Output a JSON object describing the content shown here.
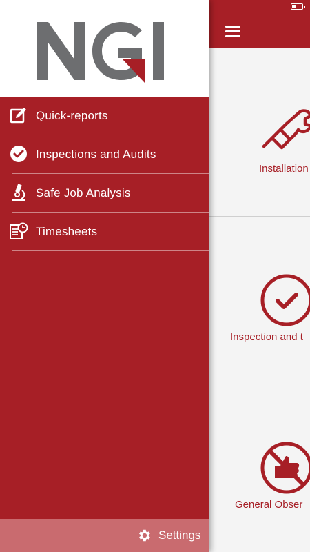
{
  "brand": {
    "logo_text": "NGI"
  },
  "drawer": {
    "items": [
      {
        "label": "Quick-reports",
        "icon": "edit-icon"
      },
      {
        "label": "Inspections and Audits",
        "icon": "check-circle-icon"
      },
      {
        "label": "Safe Job Analysis",
        "icon": "microscope-icon"
      },
      {
        "label": "Timesheets",
        "icon": "timesheet-icon"
      }
    ],
    "settings_label": "Settings"
  },
  "app": {
    "status": {
      "battery_level": 0.4
    },
    "tiles": [
      {
        "label": "Installation",
        "icon": "plug-wrench-icon"
      },
      {
        "label": "Inspection and t",
        "icon": "check-circle-icon"
      },
      {
        "label": "General Obser",
        "icon": "no-thumbs-up-icon"
      }
    ]
  },
  "colors": {
    "accent": "#a71f26",
    "logo_gray": "#6d6e70",
    "settings_bar": "#c96b6f",
    "background": "#f4f4f4"
  }
}
